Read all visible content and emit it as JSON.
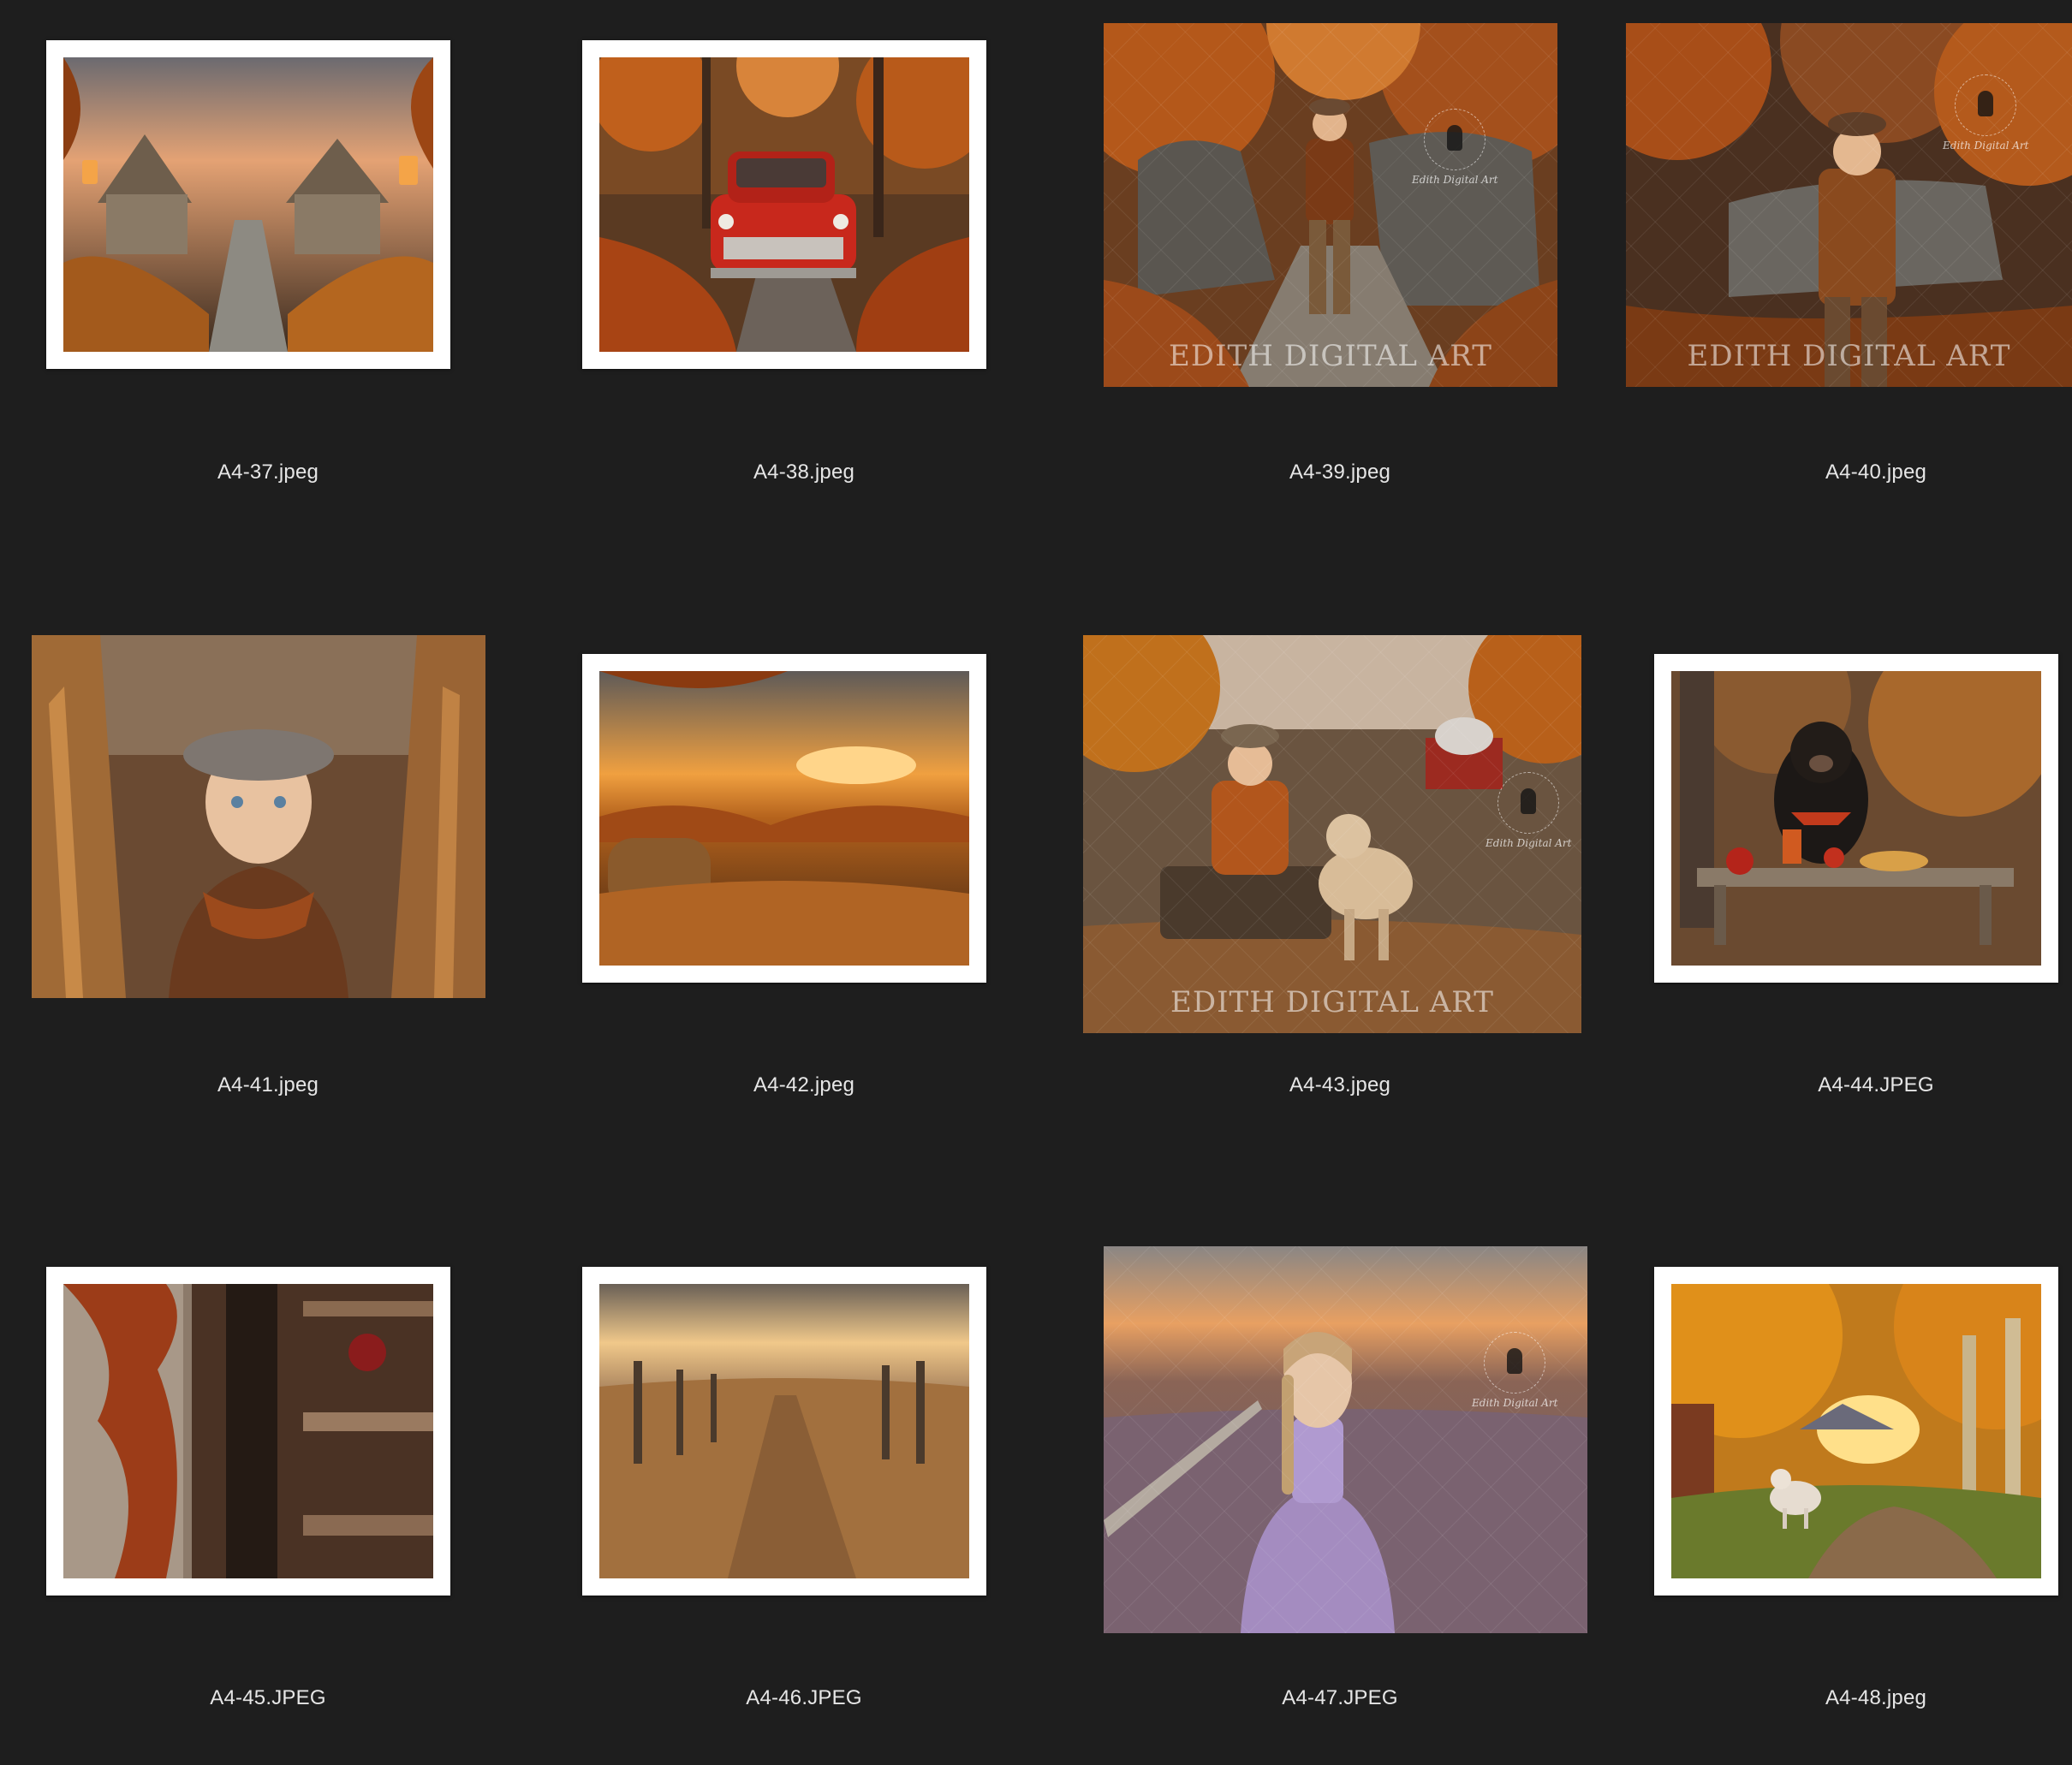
{
  "files": [
    {
      "name": "A4-37.jpeg",
      "subject": "stone path between thatched cottages with lanterns"
    },
    {
      "name": "A4-38.jpeg",
      "subject": "red vintage pickup truck on autumn leaf road"
    },
    {
      "name": "A4-39.jpeg",
      "subject": "boy in flat cap walking between rocks in fall forest",
      "watermark": "EDITH DIGITAL ART",
      "logo_text": "Edith Digital Art"
    },
    {
      "name": "A4-40.jpeg",
      "subject": "boy in plaid jacket leaning on rock in fall forest",
      "watermark": "EDITH DIGITAL ART",
      "logo_text": "Edith Digital Art"
    },
    {
      "name": "A4-41.jpeg",
      "subject": "boy in cap and knitted scarf in cornfield"
    },
    {
      "name": "A4-42.jpeg",
      "subject": "hay bale in field at autumn sunset"
    },
    {
      "name": "A4-43.jpeg",
      "subject": "boy sitting on log with calf near red barn",
      "watermark": "EDITH DIGITAL ART",
      "logo_text": "Edith Digital Art"
    },
    {
      "name": "A4-44.JPEG",
      "subject": "black bear at picnic table with apples and pie"
    },
    {
      "name": "A4-45.JPEG",
      "subject": "rustic wooden shed with autumn vines"
    },
    {
      "name": "A4-46.JPEG",
      "subject": "path through golden field with fence at sunset"
    },
    {
      "name": "A4-47.JPEG",
      "subject": "girl in lavender dress in purple flower field",
      "logo_text": "Edith Digital Art"
    },
    {
      "name": "A4-48.jpeg",
      "subject": "lamb on country road under golden trees"
    }
  ]
}
